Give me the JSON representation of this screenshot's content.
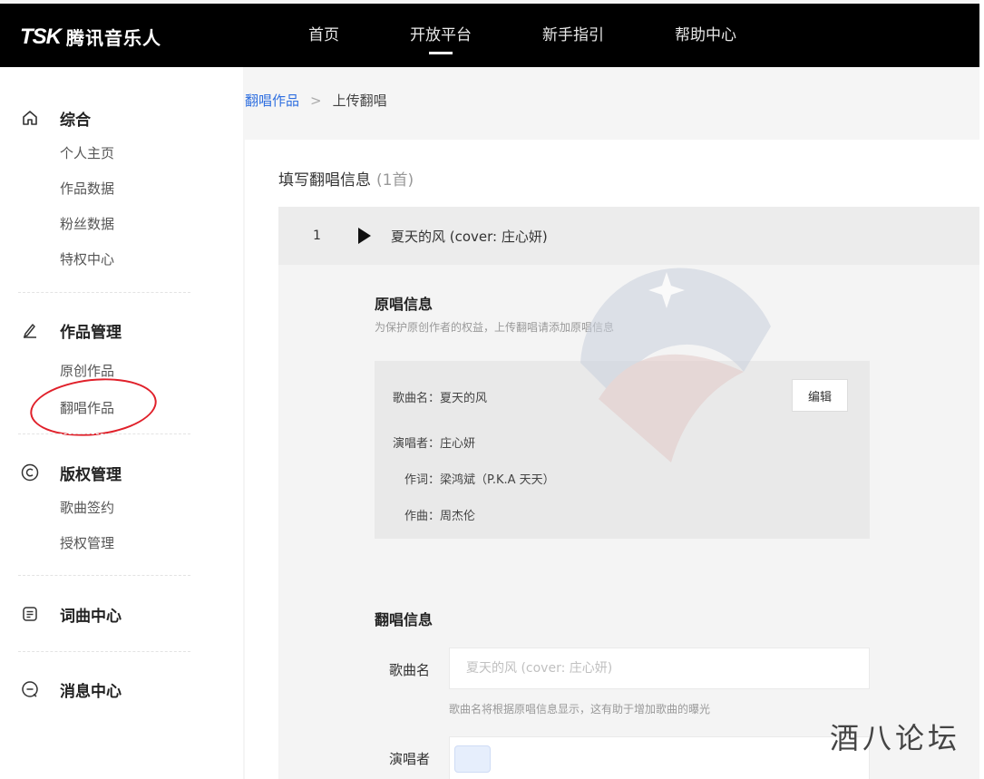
{
  "header": {
    "logo_mark": "TSK",
    "logo_text": "腾讯音乐人",
    "nav": [
      "首页",
      "开放平台",
      "新手指引",
      "帮助中心"
    ]
  },
  "sidebar": {
    "groups": [
      {
        "icon": "home-icon",
        "label": "综合",
        "items": [
          "个人主页",
          "作品数据",
          "粉丝数据",
          "特权中心"
        ]
      },
      {
        "icon": "pen-icon",
        "label": "作品管理",
        "items": [
          "原创作品",
          "翻唱作品"
        ]
      },
      {
        "icon": "copyright-icon",
        "label": "版权管理",
        "items": [
          "歌曲签约",
          "授权管理"
        ]
      },
      {
        "icon": "lyrics-icon",
        "label": "词曲中心",
        "items": []
      },
      {
        "icon": "message-icon",
        "label": "消息中心",
        "items": []
      }
    ]
  },
  "breadcrumb": {
    "link": "翻唱作品",
    "sep": ">",
    "current": "上传翻唱"
  },
  "panel": {
    "title": "填写翻唱信息",
    "count": "(1首)",
    "song": {
      "index": "1",
      "name": "夏天的风 (cover: 庄心妍)"
    },
    "original": {
      "title": "原唱信息",
      "subtitle": "为保护原创作者的权益，上传翻唱请添加原唱信息",
      "song_name": "歌曲名：夏天的风",
      "singer": "演唱者：庄心妍",
      "lyricist": "作词：梁鸿斌（P.K.A 天天）",
      "composer": "作曲：周杰伦",
      "edit_label": "编辑"
    },
    "cover": {
      "title": "翻唱信息",
      "song_label": "歌曲名",
      "song_placeholder": "夏天的风 (cover: 庄心妍)",
      "song_hint": "歌曲名将根据原唱信息显示，这有助于增加歌曲的曝光",
      "singer_label": "演唱者"
    }
  },
  "watermark": "酒八论坛"
}
